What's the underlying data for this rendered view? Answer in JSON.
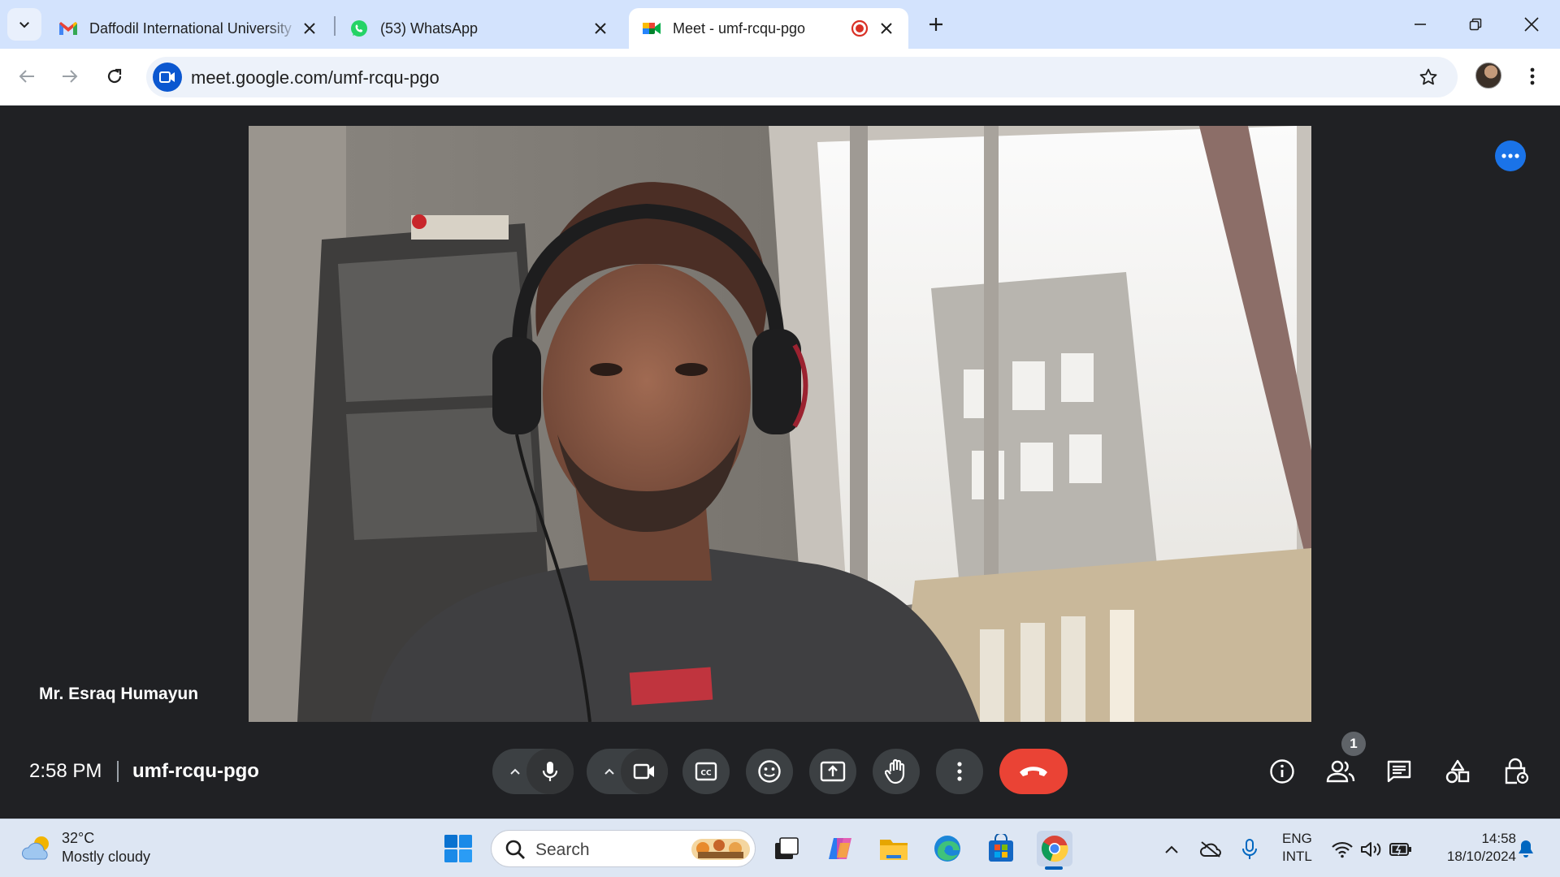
{
  "browser": {
    "tabs": [
      {
        "title": "Daffodil International University",
        "favicon": "gmail-icon",
        "active": false
      },
      {
        "title": "(53) WhatsApp",
        "favicon": "whatsapp-icon",
        "active": false
      },
      {
        "title": "Meet - umf-rcqu-pgo",
        "favicon": "google-meet-icon",
        "active": true,
        "recording": true
      }
    ],
    "url": "meet.google.com/umf-rcqu-pgo"
  },
  "meet": {
    "participant_name": "Mr. Esraq Humayun",
    "time": "2:58 PM",
    "meeting_code": "umf-rcqu-pgo",
    "people_count": "1",
    "controls": [
      "mic",
      "camera",
      "captions",
      "reactions",
      "present",
      "raise-hand",
      "more-options",
      "leave-call"
    ],
    "side_controls": [
      "meeting-details",
      "people",
      "chat",
      "activities",
      "host-controls"
    ],
    "colors": {
      "leave": "#ea4335",
      "more_button": "#1a73e8",
      "control_bg": "#3c4043"
    }
  },
  "taskbar": {
    "weather": {
      "temp": "32°C",
      "condition": "Mostly cloudy"
    },
    "search_label": "Search",
    "language": {
      "line1": "ENG",
      "line2": "INTL"
    },
    "clock": {
      "time": "14:58",
      "date": "18/10/2024"
    }
  }
}
